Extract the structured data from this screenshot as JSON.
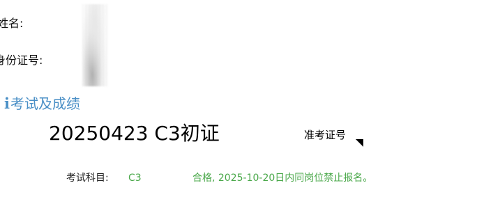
{
  "personal_info": {
    "name_label": "姓名:",
    "id_label": "身份证号:"
  },
  "section": {
    "icon": "info-icon",
    "icon_glyph": "i",
    "title": "考试及成绩"
  },
  "exam": {
    "title": "20250423 C3初证",
    "ticket_label": "准考证号",
    "subject_label": "考试科目:",
    "subject_value": "C3",
    "result_text": "合格, 2025-10-20日内同岗位禁止报名。"
  },
  "colors": {
    "accent_blue": "#4a8fc6",
    "pass_green": "#4aa84a",
    "text": "#000000"
  }
}
